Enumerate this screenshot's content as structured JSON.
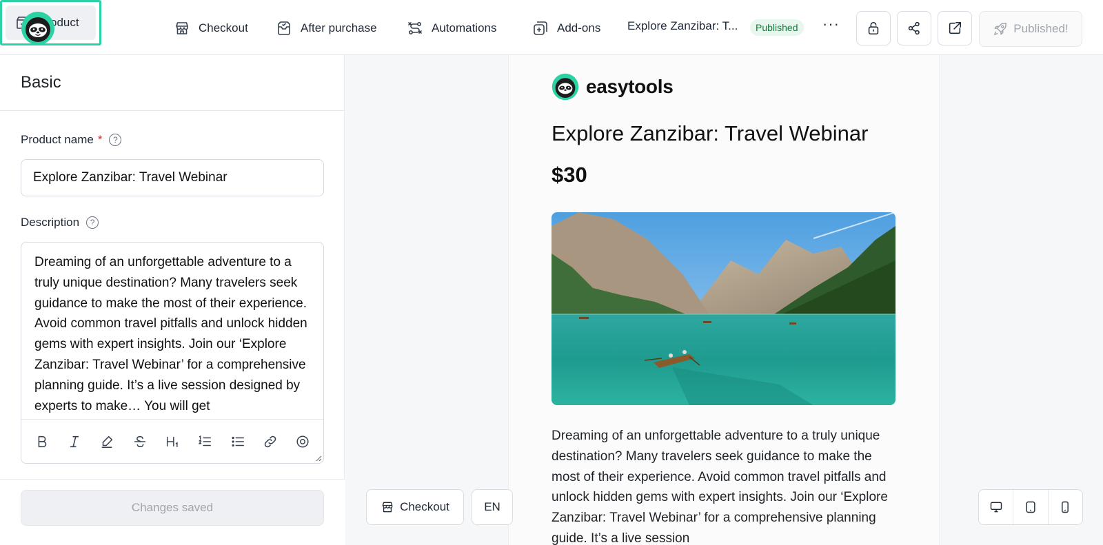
{
  "nav": {
    "product": "Product",
    "checkout": "Checkout",
    "after_purchase": "After purchase",
    "automations": "Automations",
    "addons": "Add-ons",
    "product_title_short": "Explore Zanzibar: T...",
    "status_badge": "Published",
    "more": "···",
    "published_button": "Published!"
  },
  "form": {
    "section_title": "Basic",
    "product_name_label": "Product name",
    "required_mark": "*",
    "product_name_value": "Explore Zanzibar: Travel Webinar",
    "description_label": "Description",
    "description_value": "Dreaming of an unforgettable adventure to a truly unique destination? Many travelers seek guidance to make the most of their experience. Avoid common travel pitfalls and unlock hidden gems with expert insights. Join our ‘Explore Zanzibar: Travel Webinar’ for a comprehensive planning guide. It’s a live session designed by experts to make… You will get",
    "save_status": "Changes saved"
  },
  "preview": {
    "brand_name": "easytools",
    "title": "Explore Zanzibar: Travel Webinar",
    "price": "$30",
    "description": "Dreaming of an unforgettable adventure to a truly unique destination? Many travelers seek guidance to make the most of their experience. Avoid common travel pitfalls and unlock hidden gems with expert insights. Join our ‘Explore Zanzibar: Travel Webinar’ for a comprehensive planning guide. It’s a live session",
    "checkout_button": "Checkout",
    "language": "EN"
  },
  "colors": {
    "accent": "#2bd3a4",
    "badge_bg": "#e8f7ee",
    "badge_text": "#177a3d"
  }
}
